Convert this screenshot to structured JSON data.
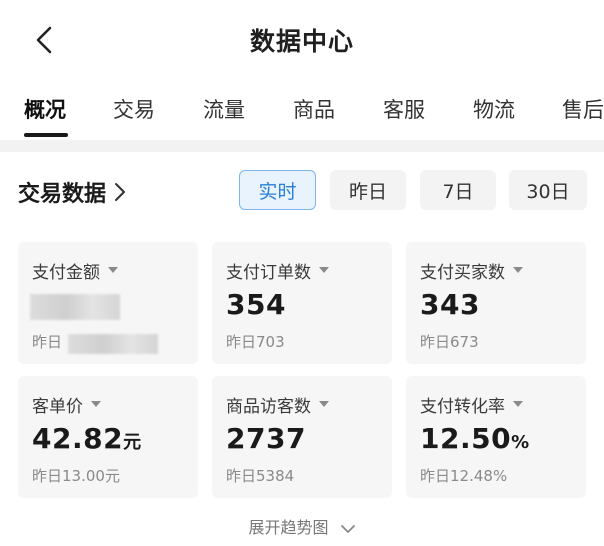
{
  "header": {
    "title": "数据中心",
    "back_icon": "chevron-left-icon"
  },
  "tabs": [
    {
      "label": "概况",
      "active": true
    },
    {
      "label": "交易",
      "active": false
    },
    {
      "label": "流量",
      "active": false
    },
    {
      "label": "商品",
      "active": false
    },
    {
      "label": "客服",
      "active": false
    },
    {
      "label": "物流",
      "active": false
    },
    {
      "label": "售后",
      "active": false
    }
  ],
  "section": {
    "title": "交易数据",
    "ranges": [
      {
        "label": "实时",
        "active": true
      },
      {
        "label": "昨日",
        "active": false
      },
      {
        "label": "7日",
        "active": false
      },
      {
        "label": "30日",
        "active": false
      }
    ]
  },
  "metrics": [
    {
      "label": "支付金额",
      "value": "",
      "unit": "",
      "prev": "昨日",
      "obscured": true
    },
    {
      "label": "支付订单数",
      "value": "354",
      "unit": "",
      "prev": "昨日703"
    },
    {
      "label": "支付买家数",
      "value": "343",
      "unit": "",
      "prev": "昨日673"
    },
    {
      "label": "客单价",
      "value": "42.82",
      "unit": "元",
      "prev": "昨日13.00元"
    },
    {
      "label": "商品访客数",
      "value": "2737",
      "unit": "",
      "prev": "昨日5384"
    },
    {
      "label": "支付转化率",
      "value": "12.50",
      "unit": "%",
      "prev": "昨日12.48%"
    }
  ],
  "expand_label": "展开趋势图",
  "colors": {
    "accent_blue": "#2b7fd6",
    "active_range_bg": "#e8f3fe",
    "card_bg": "#f6f6f6",
    "muted_text": "#8a8a8a"
  }
}
